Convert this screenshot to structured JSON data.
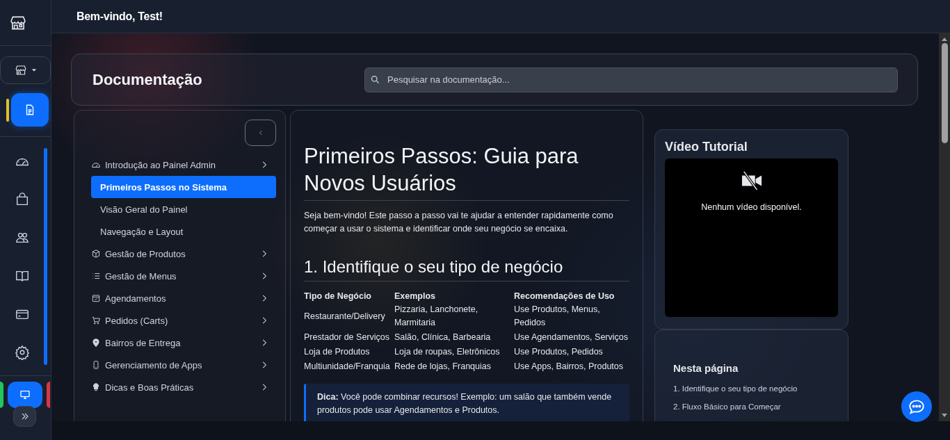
{
  "header": {
    "greeting": "Bem-vindo, Test!"
  },
  "rail": {
    "pages": [
      {
        "selected": true
      }
    ],
    "nav": [
      {
        "selected": false
      },
      {
        "selected": false
      },
      {
        "selected": false
      },
      {
        "selected": false
      },
      {
        "selected": false
      },
      {
        "selected": false
      }
    ]
  },
  "docs": {
    "title": "Documentação",
    "search": {
      "placeholder": "Pesquisar na documentação..."
    }
  },
  "sidebar": {
    "items": [
      {
        "label": "Introdução ao Painel Admin",
        "children": [
          {
            "label": "Primeiros Passos no Sistema",
            "selected": true
          },
          {
            "label": "Visão Geral do Painel",
            "selected": false
          },
          {
            "label": "Navegação e Layout",
            "selected": false
          }
        ]
      },
      {
        "label": "Gestão de Produtos"
      },
      {
        "label": "Gestão de Menus"
      },
      {
        "label": "Agendamentos"
      },
      {
        "label": "Pedidos (Carts)"
      },
      {
        "label": "Bairros de Entrega"
      },
      {
        "label": "Gerenciamento de Apps"
      },
      {
        "label": "Dicas e Boas Práticas"
      }
    ]
  },
  "article": {
    "title": "Primeiros Passos: Guia para Novos Usuários",
    "intro": "Seja bem-vindo! Este passo a passo vai te ajudar a entender rapidamente como começar a usar o sistema e identificar onde seu negócio se encaixa.",
    "section_title": "1. Identifique o seu tipo de negócio",
    "table": {
      "columns": [
        "Tipo de Negócio",
        "Exemplos",
        "Recomendações de Uso"
      ],
      "rows": [
        [
          "Restaurante/Delivery",
          "Pizzaria, Lanchonete, Marmitaria",
          "Use Produtos, Menus, Pedidos"
        ],
        [
          "Prestador de Serviços",
          "Salão, Clínica, Barbearia",
          "Use Agendamentos, Serviços"
        ],
        [
          "Loja de Produtos",
          "Loja de roupas, Eletrônicos",
          "Use Produtos, Pedidos"
        ],
        [
          "Multiunidade/Franquia",
          "Rede de lojas, Franquias",
          "Use Apps, Bairros, Produtos"
        ]
      ]
    },
    "tip": "**Dica:** Você pode combinar recursos! Exemplo: um salão que também vende produtos pode usar Agendamentos e Produtos."
  },
  "video": {
    "title": "Vídeo Tutorial",
    "empty_message": "Nenhum vídeo disponível."
  },
  "toc": {
    "title": "Nesta página",
    "items": [
      "1. Identifique o seu tipo de negócio",
      "2. Fluxo Básico para Começar"
    ]
  }
}
